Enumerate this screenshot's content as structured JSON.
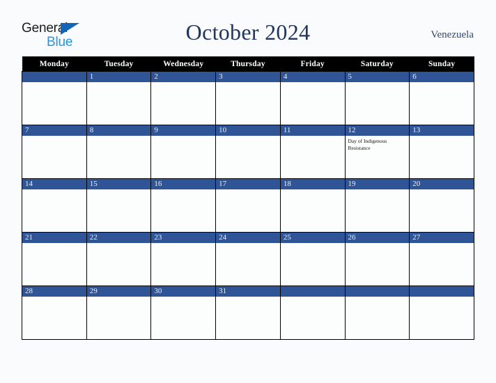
{
  "brand": {
    "word_one": "General",
    "word_two": "Blue",
    "triangle_icon": "triangle-icon",
    "accent_dark": "#1565b5",
    "accent_light": "#2196e3"
  },
  "header": {
    "title": "October 2024",
    "country": "Venezuela",
    "title_color": "#22355e"
  },
  "calendar": {
    "weekday_headers": [
      "Monday",
      "Tuesday",
      "Wednesday",
      "Thursday",
      "Friday",
      "Saturday",
      "Sunday"
    ],
    "header_bg": "#000000",
    "daybar_bg": "#2f5597",
    "cell_bg": "#fcfdfd",
    "weeks": [
      [
        {
          "day": "",
          "events": []
        },
        {
          "day": "1",
          "events": []
        },
        {
          "day": "2",
          "events": []
        },
        {
          "day": "3",
          "events": []
        },
        {
          "day": "4",
          "events": []
        },
        {
          "day": "5",
          "events": []
        },
        {
          "day": "6",
          "events": []
        }
      ],
      [
        {
          "day": "7",
          "events": []
        },
        {
          "day": "8",
          "events": []
        },
        {
          "day": "9",
          "events": []
        },
        {
          "day": "10",
          "events": []
        },
        {
          "day": "11",
          "events": []
        },
        {
          "day": "12",
          "events": [
            "Day of Indigenous Resistance"
          ]
        },
        {
          "day": "13",
          "events": []
        }
      ],
      [
        {
          "day": "14",
          "events": []
        },
        {
          "day": "15",
          "events": []
        },
        {
          "day": "16",
          "events": []
        },
        {
          "day": "17",
          "events": []
        },
        {
          "day": "18",
          "events": []
        },
        {
          "day": "19",
          "events": []
        },
        {
          "day": "20",
          "events": []
        }
      ],
      [
        {
          "day": "21",
          "events": []
        },
        {
          "day": "22",
          "events": []
        },
        {
          "day": "23",
          "events": []
        },
        {
          "day": "24",
          "events": []
        },
        {
          "day": "25",
          "events": []
        },
        {
          "day": "26",
          "events": []
        },
        {
          "day": "27",
          "events": []
        }
      ],
      [
        {
          "day": "28",
          "events": []
        },
        {
          "day": "29",
          "events": []
        },
        {
          "day": "30",
          "events": []
        },
        {
          "day": "31",
          "events": []
        },
        {
          "day": "",
          "events": []
        },
        {
          "day": "",
          "events": []
        },
        {
          "day": "",
          "events": []
        }
      ]
    ]
  }
}
